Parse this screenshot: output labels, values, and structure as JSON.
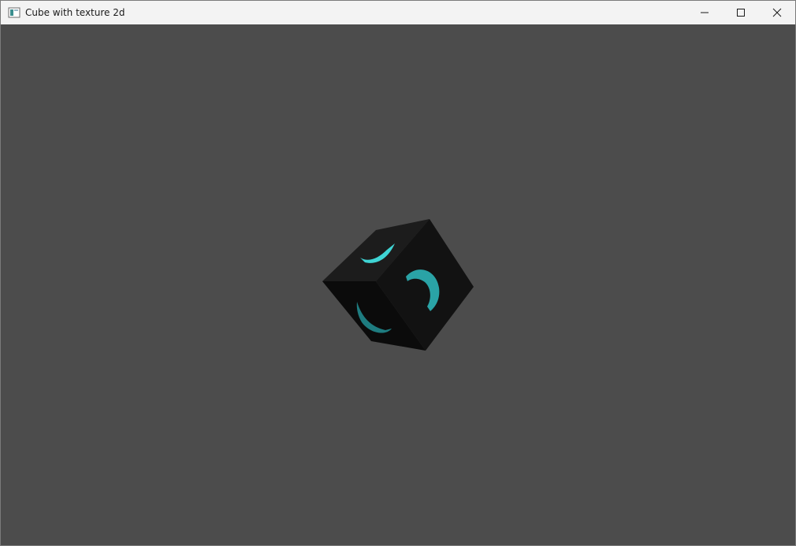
{
  "window": {
    "title": "Cube with texture 2d",
    "app_icon": "window-app-icon",
    "controls": [
      "minimize-icon",
      "maximize-icon",
      "close-icon"
    ]
  },
  "colors": {
    "titlebar_bg": "#f3f3f3",
    "viewport_bg": "#4c4c4c",
    "cube_face_top": "#1c1c1c",
    "cube_face_right": "#141414",
    "cube_face_left": "#0c0c0c",
    "texture_glyph_bright": "#3fd4d4",
    "texture_glyph_mid": "#2aa3a6",
    "texture_glyph_dark": "#1e7c80"
  }
}
